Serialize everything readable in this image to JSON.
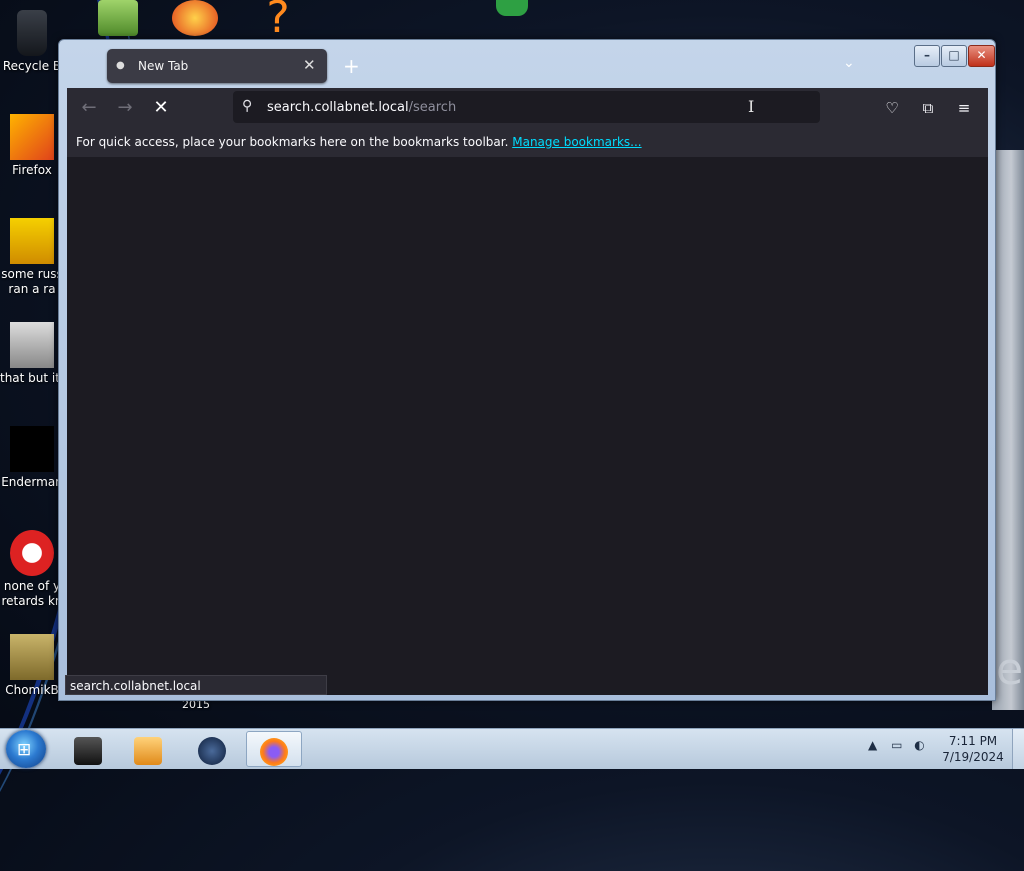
{
  "desktop": {
    "icons": [
      {
        "label": "Recycle B"
      },
      {
        "label": "Firefox"
      },
      {
        "label": "some russ",
        "label2": "ran a ra"
      },
      {
        "label": "that but its"
      },
      {
        "label": "Enderman"
      },
      {
        "label": "none of y",
        "label2": "retards kn"
      },
      {
        "label": "ChomikB"
      }
    ],
    "year_label": "2015"
  },
  "browser": {
    "tab": {
      "title": "New Tab"
    },
    "url_host": "search.collabnet.local",
    "url_path": "/search",
    "bookmarks_bar": {
      "text": "For quick access, place your bookmarks here on the bookmarks toolbar.",
      "link": "Manage bookmarks..."
    },
    "status_text": "search.collabnet.local"
  },
  "taskbar": {
    "clock_time": "7:11 PM",
    "clock_date": "7/19/2024"
  },
  "colors": {
    "accent_link": "#00ddff",
    "browser_bg": "#1c1b22",
    "toolbar_bg": "#2b2a33"
  }
}
